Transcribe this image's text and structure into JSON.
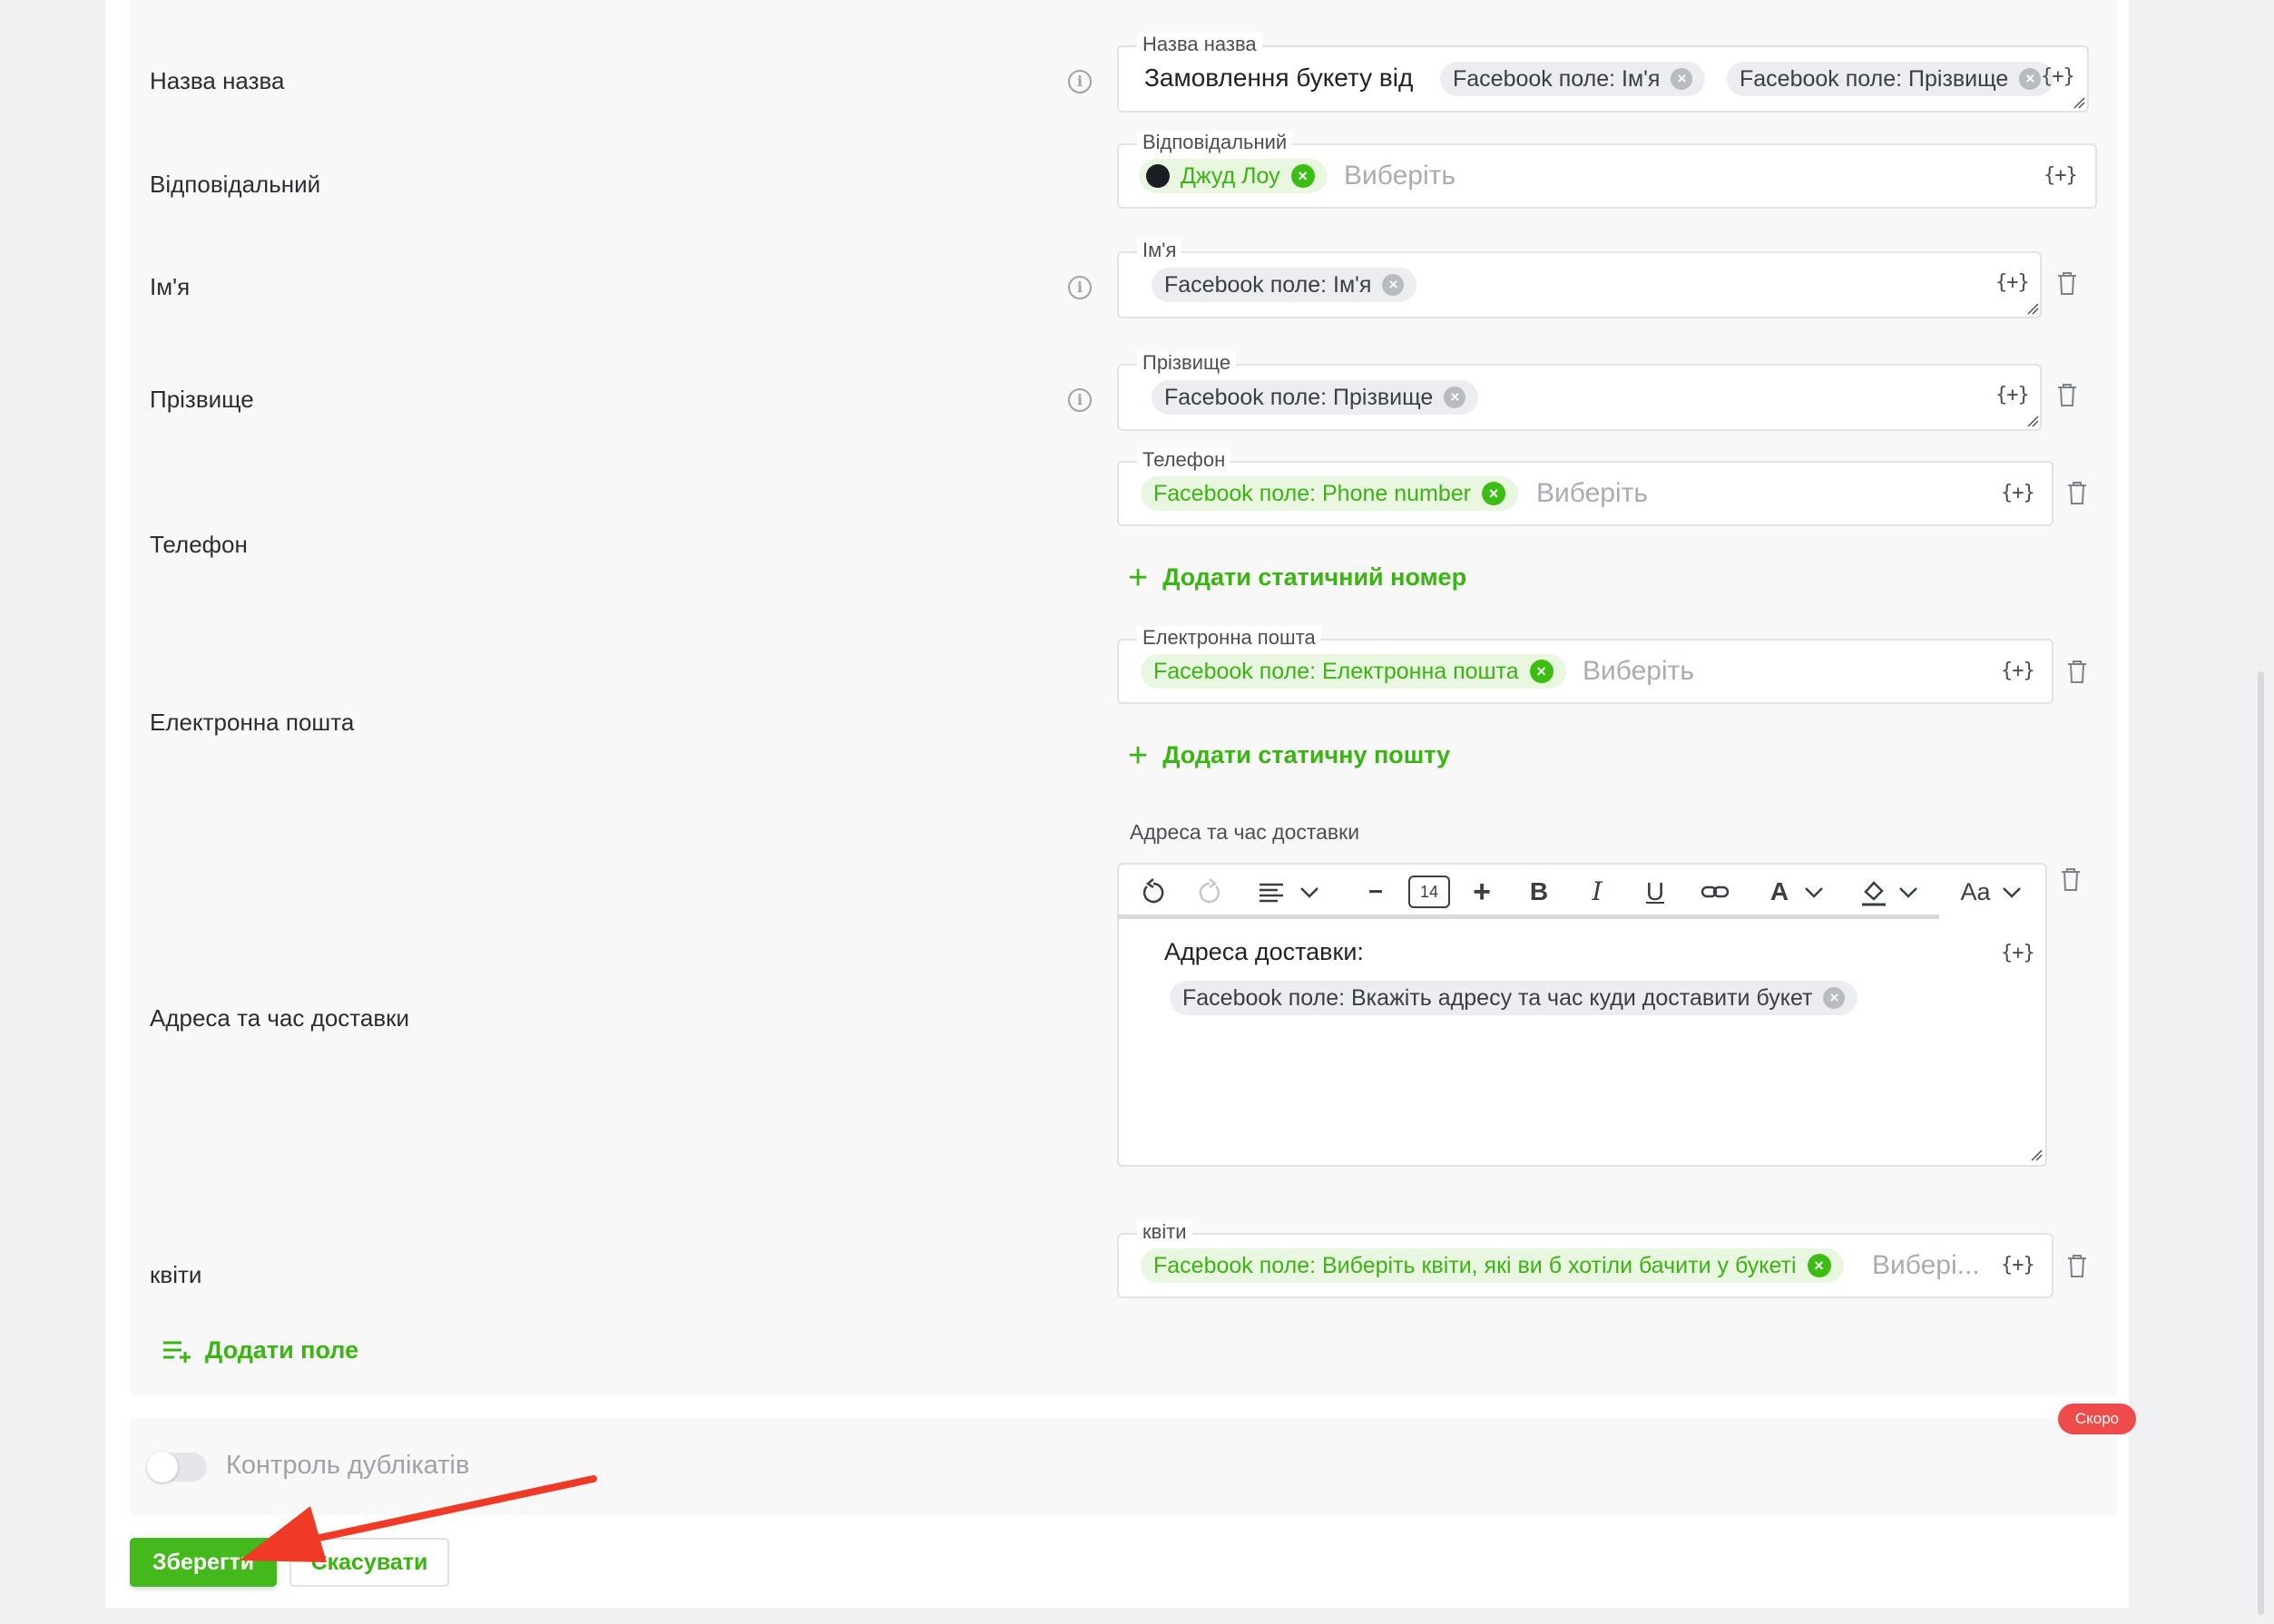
{
  "rows": {
    "title": {
      "label": "Назва назва",
      "field_label": "Назва назва",
      "text": "Замовлення букету від",
      "chips": [
        "Facebook поле: Ім'я",
        "Facebook поле: Прізвище"
      ]
    },
    "responsible": {
      "label": "Відповідальний",
      "field_label": "Відповідальний",
      "chip": "Джуд Лоу",
      "placeholder": "Виберіть"
    },
    "first_name": {
      "label": "Ім'я",
      "field_label": "Ім'я",
      "chip": "Facebook поле: Ім'я"
    },
    "last_name": {
      "label": "Прізвище",
      "field_label": "Прізвище",
      "chip": "Facebook поле: Прізвище"
    },
    "phone": {
      "label": "Телефон",
      "field_label": "Телефон",
      "chip": "Facebook поле: Phone number",
      "placeholder": "Виберіть",
      "add_link": "Додати статичний номер"
    },
    "email": {
      "label": "Електронна пошта",
      "field_label": "Електронна пошта",
      "chip": "Facebook поле: Електронна пошта",
      "placeholder": "Виберіть",
      "add_link": "Додати статичну пошту"
    },
    "delivery": {
      "label": "Адреса та час доставки",
      "field_label": "Адреса та час доставки",
      "editor_heading": "Адреса доставки:",
      "chip": "Facebook поле: Вкажіть адресу та час куди доставити букет",
      "font_size": "14",
      "font_label": "Aa"
    },
    "flowers": {
      "label": "квіти",
      "field_label": "квіти",
      "chip": "Facebook поле: Виберіть квіти, які ви б хотіли бачити у букеті",
      "placeholder": "Вибері..."
    }
  },
  "insert_variable": "{+}",
  "add_field": "Додати поле",
  "duplicates": {
    "label": "Контроль дублікатів",
    "badge": "Скоро"
  },
  "buttons": {
    "save": "Зберегти",
    "cancel": "Скасувати"
  },
  "colors": {
    "accent": "#43b91b",
    "badge": "#f04b4b",
    "arrow": "#f13a25"
  }
}
